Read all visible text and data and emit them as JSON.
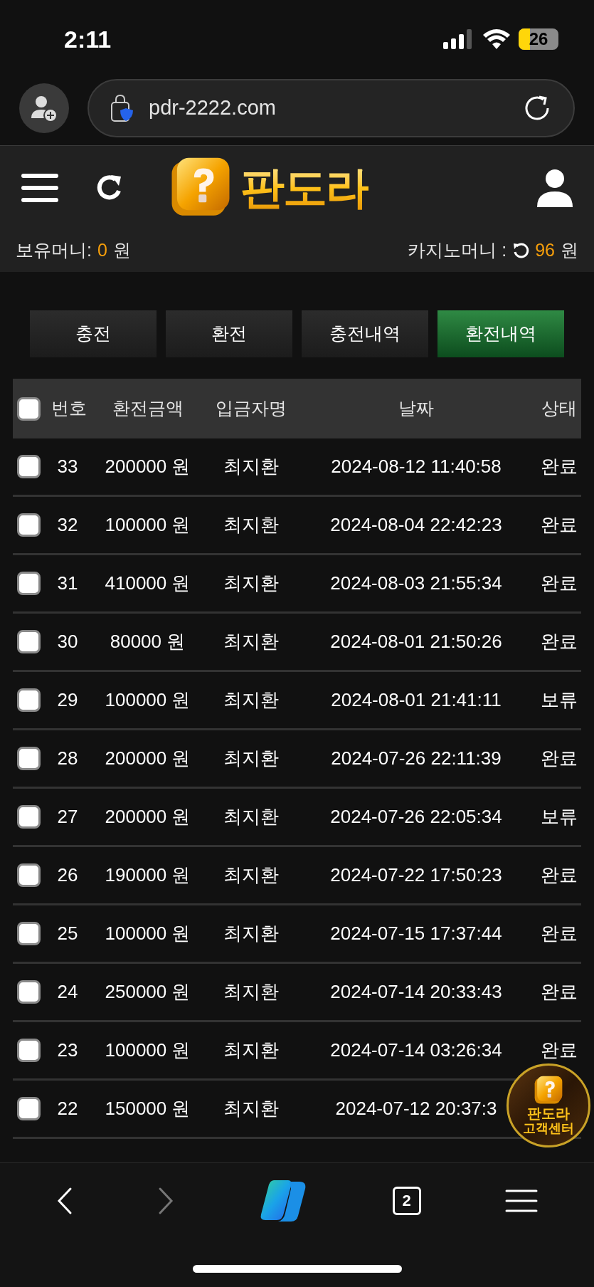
{
  "status_bar": {
    "time": "2:11",
    "battery": "26"
  },
  "browser": {
    "url": "pdr-2222.com"
  },
  "header": {
    "brand": "판도라",
    "wallet_label": "보유머니:",
    "wallet_amount": "0",
    "wallet_unit": "원",
    "casino_label": "카지노머니 :",
    "casino_amount": "96",
    "casino_unit": "원"
  },
  "tabs": [
    {
      "label": "충전",
      "selected": false
    },
    {
      "label": "환전",
      "selected": false
    },
    {
      "label": "충전내역",
      "selected": false
    },
    {
      "label": "환전내역",
      "selected": true
    }
  ],
  "table": {
    "select_all_checked": false,
    "columns": [
      "번호",
      "환전금액",
      "입금자명",
      "날짜",
      "상태"
    ],
    "rows": [
      {
        "checked": false,
        "no": "33",
        "amount": "200000 원",
        "name": "최지환",
        "date": "2024-08-12 11:40:58",
        "status": "완료"
      },
      {
        "checked": false,
        "no": "32",
        "amount": "100000 원",
        "name": "최지환",
        "date": "2024-08-04 22:42:23",
        "status": "완료"
      },
      {
        "checked": false,
        "no": "31",
        "amount": "410000 원",
        "name": "최지환",
        "date": "2024-08-03 21:55:34",
        "status": "완료"
      },
      {
        "checked": false,
        "no": "30",
        "amount": "80000 원",
        "name": "최지환",
        "date": "2024-08-01 21:50:26",
        "status": "완료"
      },
      {
        "checked": false,
        "no": "29",
        "amount": "100000 원",
        "name": "최지환",
        "date": "2024-08-01 21:41:11",
        "status": "보류"
      },
      {
        "checked": false,
        "no": "28",
        "amount": "200000 원",
        "name": "최지환",
        "date": "2024-07-26 22:11:39",
        "status": "완료"
      },
      {
        "checked": false,
        "no": "27",
        "amount": "200000 원",
        "name": "최지환",
        "date": "2024-07-26 22:05:34",
        "status": "보류"
      },
      {
        "checked": false,
        "no": "26",
        "amount": "190000 원",
        "name": "최지환",
        "date": "2024-07-22 17:50:23",
        "status": "완료"
      },
      {
        "checked": false,
        "no": "25",
        "amount": "100000 원",
        "name": "최지환",
        "date": "2024-07-15 17:37:44",
        "status": "완료"
      },
      {
        "checked": false,
        "no": "24",
        "amount": "250000 원",
        "name": "최지환",
        "date": "2024-07-14 20:33:43",
        "status": "완료"
      },
      {
        "checked": false,
        "no": "23",
        "amount": "100000 원",
        "name": "최지환",
        "date": "2024-07-14 03:26:34",
        "status": "완료"
      },
      {
        "checked": false,
        "no": "22",
        "amount": "150000 원",
        "name": "최지환",
        "date": "2024-07-12 20:37:3"
      }
    ]
  },
  "support_badge": {
    "line1": "판도라",
    "line2": "고객센터"
  },
  "toolbar": {
    "tab_count": "2",
    "forward_disabled": true
  }
}
